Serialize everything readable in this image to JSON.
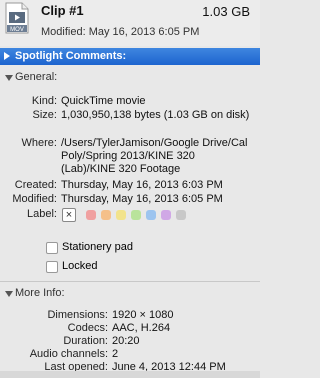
{
  "file": {
    "title": "Clip #1",
    "size": "1.03 GB",
    "modified": "Modified: May 16, 2013 6:05 PM",
    "icon_badge": "MOV"
  },
  "spotlight": {
    "label": "Spotlight Comments:"
  },
  "general": {
    "label": "General:",
    "kind_k": "Kind:",
    "kind_v": "QuickTime movie",
    "size_k": "Size:",
    "size_v": "1,030,950,138 bytes (1.03 GB on disk)",
    "where_k": "Where:",
    "where_v": "/Users/TylerJamison/Google Drive/Cal Poly/Spring 2013/KINE 320 (Lab)/KINE 320 Footage",
    "created_k": "Created:",
    "created_v": "Thursday, May 16, 2013 6:03 PM",
    "modified_k": "Modified:",
    "modified_v": "Thursday, May 16, 2013 6:05 PM",
    "label_k": "Label:",
    "label_colors": [
      "#f0a0a0",
      "#f5c08a",
      "#f2e38c",
      "#b9e39b",
      "#9cc4ef",
      "#d0a8e6",
      "#c8c8c8"
    ],
    "stationery": "Stationery pad",
    "locked": "Locked"
  },
  "more": {
    "label": "More Info:",
    "dimensions_k": "Dimensions:",
    "dimensions_v": "1920 × 1080",
    "codecs_k": "Codecs:",
    "codecs_v": "AAC, H.264",
    "duration_k": "Duration:",
    "duration_v": "20:20",
    "audio_k": "Audio channels:",
    "audio_v": "2",
    "last_k": "Last opened:",
    "last_v": "June 4, 2013 12:44 PM"
  }
}
